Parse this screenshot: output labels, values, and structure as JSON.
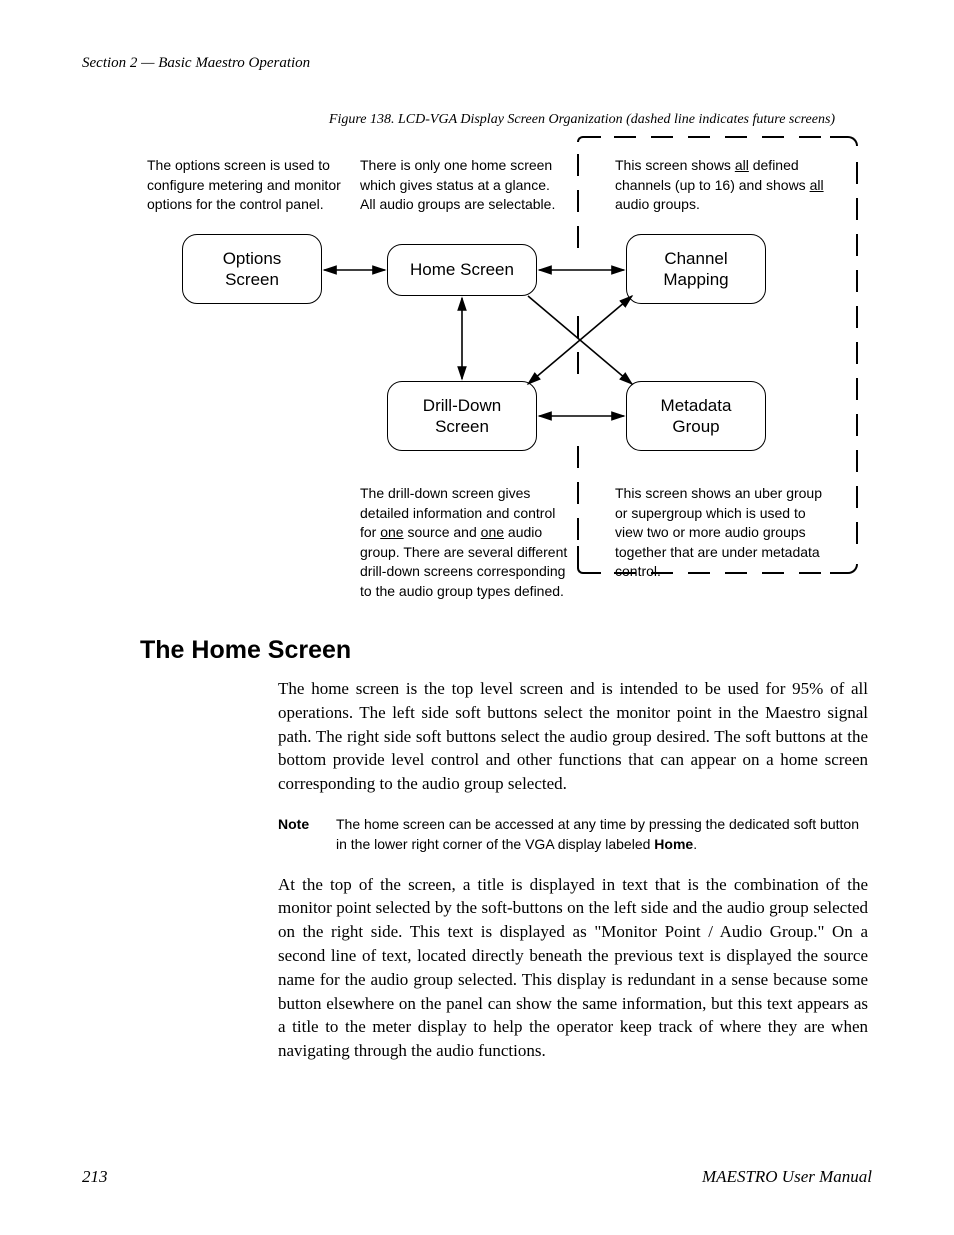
{
  "header": {
    "section_line": "Section 2  —  Basic Maestro Operation"
  },
  "figure": {
    "caption": "Figure 138.  LCD-VGA Display Screen Organization (dashed line indicates future screens)"
  },
  "notes": {
    "options": "The options screen is used to configure metering and monitor options for the control panel.",
    "home": "There is only one home screen which gives status at a glance. All audio groups are selectable.",
    "channel_pre": "This screen shows ",
    "channel_u1": "all",
    "channel_mid": " defined channels (up to 16) and shows ",
    "channel_u2": "all",
    "channel_post": " audio groups.",
    "drill_pre": "The drill-down screen gives detailed information and control for ",
    "drill_u1": "one",
    "drill_mid1": " source and ",
    "drill_u2": "one",
    "drill_mid2": " audio group. There are several different drill-down screens corresponding to the audio group types defined.",
    "metadata": "This screen shows an uber group or supergroup which is used to view two or more audio groups together that are under metadata control."
  },
  "nodes": {
    "options": "Options\nScreen",
    "home": "Home Screen",
    "channel": "Channel\nMapping",
    "drill": "Drill-Down\nScreen",
    "metadata": "Metadata\nGroup"
  },
  "section": {
    "heading": "The Home Screen",
    "p1": "The home screen is the top level screen and is intended to be used for 95% of all operations.  The left side soft buttons select the monitor point in the Maestro signal path.  The right side soft buttons select the audio group desired. The soft buttons at the bottom provide level control and other functions that can appear on a home screen corresponding to the audio group selected.",
    "note_label": "Note",
    "note_text_pre": "The home screen can be accessed at any time by pressing the dedicated soft button in the lower right corner of the VGA display labeled ",
    "note_text_b": "Home",
    "note_text_post": ".",
    "p2": "At the top of the screen, a title is displayed in text that is the combination of the monitor point selected by the soft-buttons on the left side and the audio group selected on the right side.  This text is displayed as \"Monitor Point / Audio Group.\"  On a second line of text, located directly beneath the previous text is displayed the source name for the audio group selected. This display is redundant in a sense because some button elsewhere on the panel can show the same information, but this text appears as a title to the meter display to help the operator keep track of where they are when navigating through the audio functions."
  },
  "footer": {
    "page": "213",
    "doc": "MAESTRO User Manual"
  }
}
